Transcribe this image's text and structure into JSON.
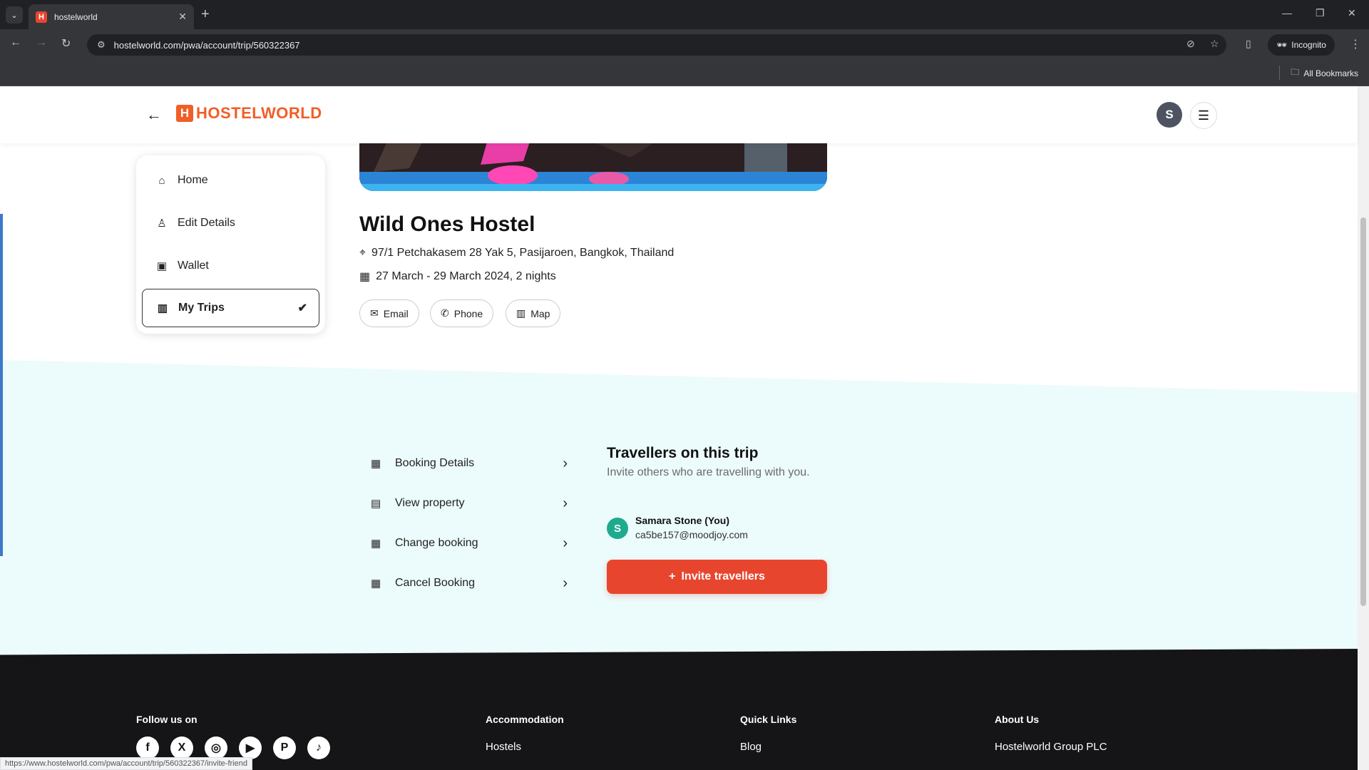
{
  "browser": {
    "tab_title": "hostelworld",
    "tab_favicon": "H",
    "url": "hostelworld.com/pwa/account/trip/560322367",
    "incognito_label": "Incognito",
    "all_bookmarks_label": "All Bookmarks",
    "status_url": "https://www.hostelworld.com/pwa/account/trip/560322367/invite-friend"
  },
  "header": {
    "logo_mark": "H",
    "logo_text": "HOSTELWORLD",
    "avatar_initial": "S"
  },
  "sidebar": {
    "items": [
      {
        "label": "Home",
        "icon": "home-icon"
      },
      {
        "label": "Edit Details",
        "icon": "user-icon"
      },
      {
        "label": "Wallet",
        "icon": "wallet-icon"
      },
      {
        "label": "My Trips",
        "icon": "map-icon",
        "active": true
      }
    ]
  },
  "property": {
    "name": "Wild Ones Hostel",
    "address": "97/1 Petchakasem 28 Yak 5, Pasijaroen, Bangkok, Thailand",
    "dates": "27 March - 29 March 2024, 2 nights",
    "buttons": {
      "email": "Email",
      "phone": "Phone",
      "map": "Map"
    }
  },
  "actions": [
    {
      "label": "Booking Details",
      "icon": "calendar-icon"
    },
    {
      "label": "View property",
      "icon": "building-icon"
    },
    {
      "label": "Change booking",
      "icon": "calendar-edit-icon"
    },
    {
      "label": "Cancel Booking",
      "icon": "calendar-x-icon"
    }
  ],
  "travellers": {
    "title": "Travellers on this trip",
    "subtitle": "Invite others who are travelling with you.",
    "traveller_initial": "S",
    "traveller_name": "Samara Stone (You)",
    "traveller_email": "ca5be157@moodjoy.com",
    "invite_label": "Invite travellers"
  },
  "footer": {
    "follow_label": "Follow us on",
    "accommodation_heading": "Accommodation",
    "accommodation_link": "Hostels",
    "quick_links_heading": "Quick Links",
    "quick_links_link": "Blog",
    "about_heading": "About Us",
    "about_link": "Hostelworld Group PLC"
  },
  "colors": {
    "brand_orange": "#f25e27",
    "invite_button": "#e8452f",
    "band_background": "#ecfbfb",
    "footer_background": "#151416"
  }
}
